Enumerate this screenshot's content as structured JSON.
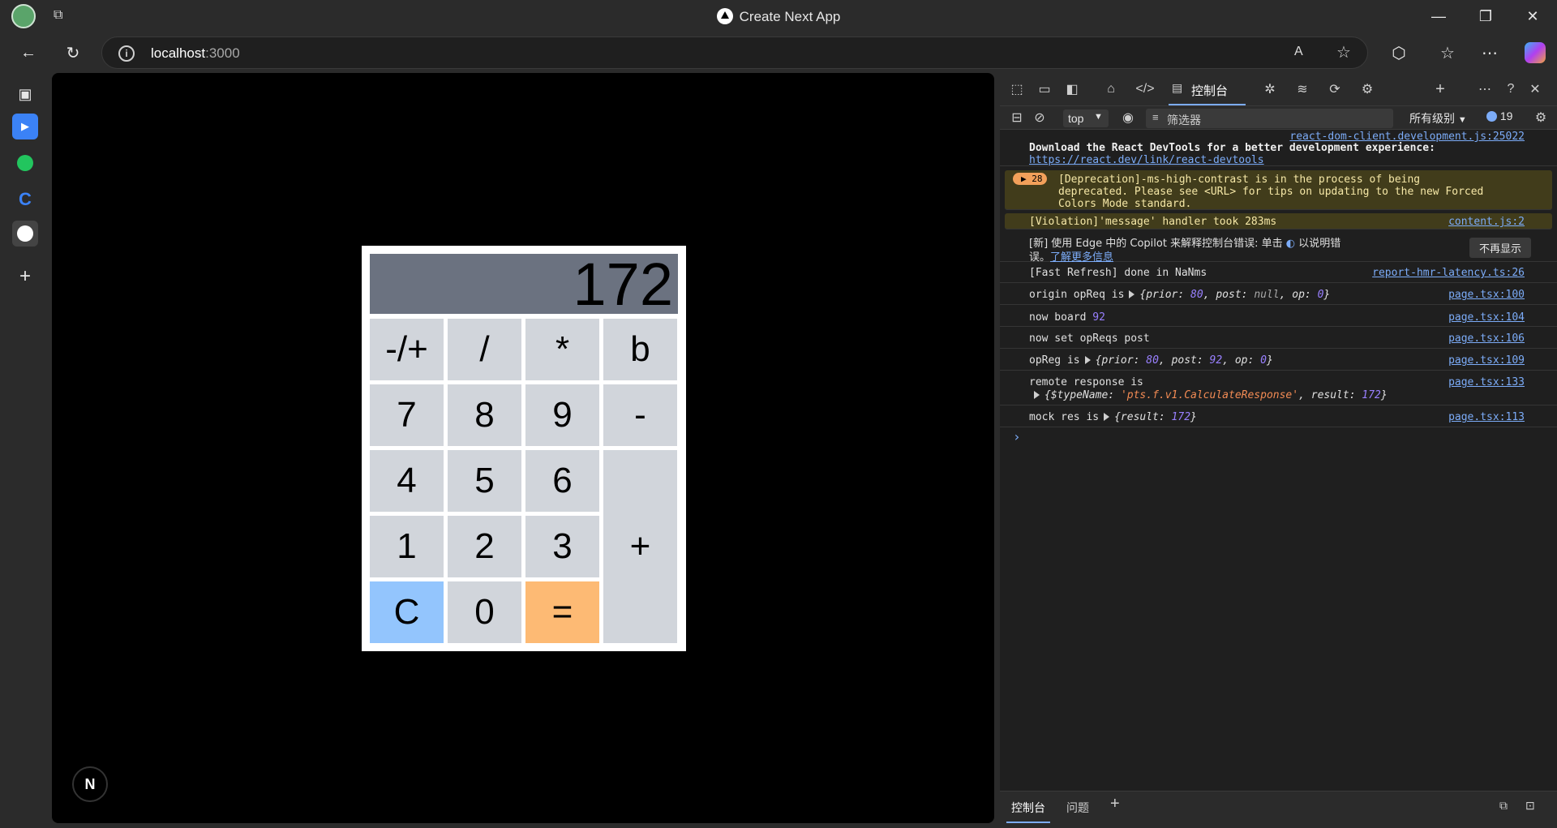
{
  "window": {
    "title": "Create Next App"
  },
  "address": {
    "host": "localhost",
    "port": ":3000"
  },
  "calculator": {
    "display": "172",
    "keys": {
      "negate": "-/+",
      "divide": "/",
      "multiply": "*",
      "backspace": "b",
      "seven": "7",
      "eight": "8",
      "nine": "9",
      "minus": "-",
      "four": "4",
      "five": "5",
      "six": "6",
      "plus": "+",
      "one": "1",
      "two": "2",
      "three": "3",
      "clear": "C",
      "zero": "0",
      "equals": "="
    },
    "colors": {
      "display_bg": "#6b7280",
      "key_bg": "#d1d5db",
      "clear_bg": "#93c5fd",
      "equals_bg": "#fdba74"
    }
  },
  "next_badge": "N",
  "devtools": {
    "tabs": {
      "console": "控制台",
      "add": "+"
    },
    "toolbar": {
      "context": "top",
      "filter_placeholder": "筛选器",
      "levels": "所有级别",
      "issues_count": "19"
    },
    "console_rows": {
      "react_src": "react-dom-client.development.js:25022",
      "react_msg": "Download the React DevTools for a better development experience:",
      "react_link": "https://react.dev/link/react-devtools",
      "deprecation_count": "28",
      "deprecation_line1": "[Deprecation]-ms-high-contrast is in the process of being",
      "deprecation_line2": "deprecated. Please see <URL> for tips on updating to the new Forced",
      "deprecation_line3": "Colors Mode standard.",
      "violation_msg": "[Violation]'message' handler took 283ms",
      "violation_src": "content.js:2",
      "copilot_line1": "[新] 使用 Edge 中的 Copilot 来解释控制台错误: 单击",
      "copilot_line1b": "以说明错",
      "copilot_line2a": "误。",
      "copilot_link": "了解更多信息",
      "copilot_button": "不再显示",
      "fastrefresh_msg": "[Fast Refresh] done in NaNms",
      "fastrefresh_src": "report-hmr-latency.ts:26",
      "origin_msg": "origin opReq is",
      "origin_obj_prior_key": "prior:",
      "origin_obj_prior_val": "80",
      "origin_obj_post_key": "post:",
      "origin_obj_post_val": "null",
      "origin_obj_op_key": "op:",
      "origin_obj_op_val": "0",
      "origin_src": "page.tsx:100",
      "board_msg": "now board",
      "board_val": "92",
      "board_src": "page.tsx:104",
      "setpost_msg": "now set opReqs post",
      "setpost_src": "page.tsx:106",
      "opreg_msg": "opReg is",
      "opreg_prior_val": "80",
      "opreg_post_val": "92",
      "opreg_op_val": "0",
      "opreg_src": "page.tsx:109",
      "remote_msg": "remote response is",
      "remote_typename_key": "$typeName:",
      "remote_typename_val": "'pts.f.v1.CalculateResponse'",
      "remote_result_key": "result:",
      "remote_result_val": "172",
      "remote_src": "page.tsx:133",
      "mock_msg": "mock res is",
      "mock_result_key": "result:",
      "mock_result_val": "172",
      "mock_src": "page.tsx:113",
      "prompt": "›"
    },
    "bottom_tabs": {
      "console": "控制台",
      "issues": "问题",
      "add": "+"
    }
  }
}
